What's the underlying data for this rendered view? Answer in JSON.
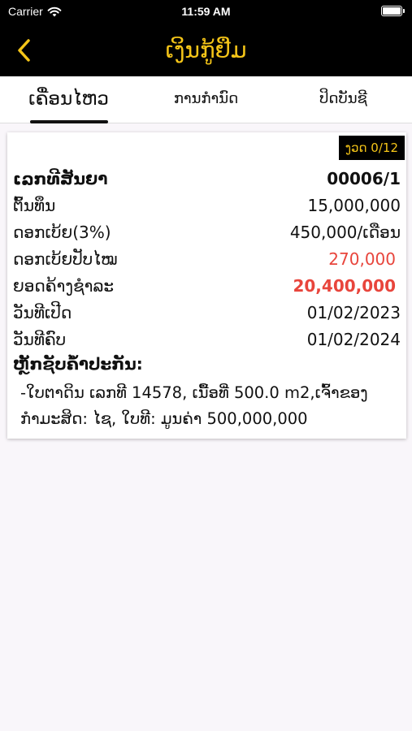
{
  "status_bar": {
    "carrier": "Carrier",
    "time": "11:59 AM"
  },
  "nav": {
    "title": "ເງິນກູ້ຢືມ",
    "back_icon": "chevron-left-icon",
    "accent_color": "#f5c518"
  },
  "tabs": [
    {
      "label": "ເຄື່ອນໄຫວ",
      "active": true
    },
    {
      "label": "ການກຳນົດ",
      "active": false
    },
    {
      "label": "ປິດບັນຊີ",
      "active": false
    }
  ],
  "loan": {
    "installment_badge": "ງວດ 0/12",
    "contract_label": "ເລກທີສັນຍາ",
    "contract_value": "00006/1",
    "principal_label": "ຕົ້ນທຶນ",
    "principal_value": "15,000,000",
    "interest_label": "ດອກເບ້ຍ(3%)",
    "interest_value": "450,000/ເດືອນ",
    "penalty_label": "ດອກເບ້ຍປັບໄໝ",
    "penalty_value": "270,000",
    "outstanding_label": "ຍອດຄ້າງຊຳລະ",
    "outstanding_value": "20,400,000",
    "open_date_label": "ວັນທີເປີດ",
    "open_date_value": "01/02/2023",
    "end_date_label": "ວັນທີຄົບ",
    "end_date_value": "01/02/2024",
    "collateral_title": "ຫຼັກຊັບຄໍ້າປະກັນ:",
    "collateral_text": "-ໃບຕາດິນ ເລກທີ 14578, ເນື້ອທີ່ 500.0 m2,ເຈົ້າຂອງກຳມະສິດ: ໄຊ, ໃບທີ:  ມູນຄ່າ 500,000,000",
    "highlight_color": "#e8453c"
  }
}
